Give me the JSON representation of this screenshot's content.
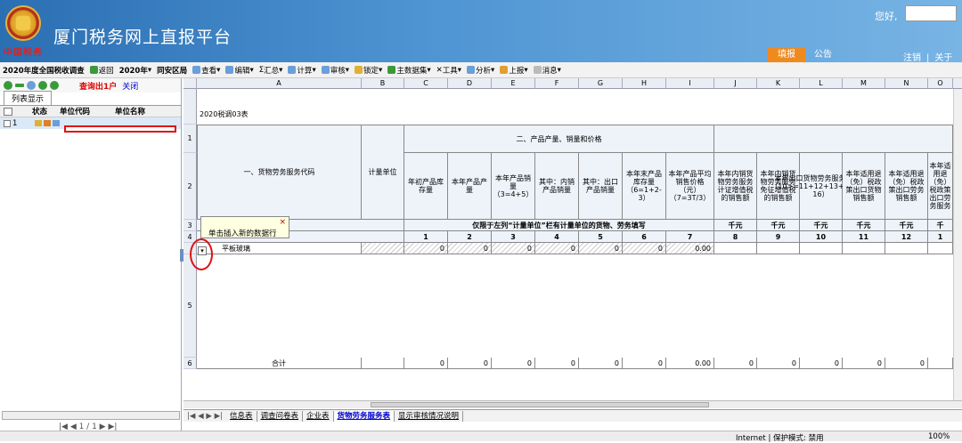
{
  "header": {
    "title": "厦门税务网上直报平台",
    "logo_text": "中国税务",
    "greeting": "您好,",
    "tab_active": "填报",
    "tab_other": "公告",
    "link_logout": "注销",
    "link_about": "关于"
  },
  "toolbar": {
    "survey": "2020年度全国税收调查",
    "back": "返回",
    "year": "2020年",
    "district": "同安区局",
    "items": [
      "查看",
      "编辑",
      "汇总",
      "计算",
      "审核",
      "锁定",
      "主数据集",
      "工具",
      "分析",
      "上报",
      "消息"
    ]
  },
  "left": {
    "query": "查询出1户",
    "close": "关闭",
    "tab": "列表显示",
    "col_status": "状态",
    "col_code": "单位代码",
    "col_name": "单位名称",
    "row_num": "1",
    "pager": "|◀ ◀  1 / 1  ▶ ▶|"
  },
  "sheet": {
    "col_letters": [
      "A",
      "B",
      "C",
      "D",
      "E",
      "F",
      "G",
      "H",
      "I",
      "J",
      "K",
      "L",
      "M",
      "N",
      "O"
    ],
    "row_labels": [
      "1",
      "2",
      "3",
      "4",
      "",
      "5",
      "6"
    ],
    "table_code": "2020税调03表",
    "h_a": "一、货物劳务服务代码",
    "h_b": "计量单位",
    "h_group": "二、产品产量、销量和价格",
    "h_cols": [
      "年初产品库存量",
      "本年产品产量",
      "本年产品销量（3=4+5）",
      "其中：内销产品销量",
      "其中：出口产品销量",
      "本年末产品库存量（6=1+2-3）",
      "本年产品平均销售价格（元）（7=3T/3）",
      "本年内销货物劳务服务计证增值税的销售额",
      "本年内销货物劳务服务免征增值税的销售额",
      "本年出口货物劳务服务销售额（10>=11+12+13+14+15-16）",
      "本年适用退（免）税政策出口货物销售额",
      "本年适用退（免）税政策出口劳务销售额",
      "本年适用退（免）税政策出口劳务服务"
    ],
    "note_row3": "仅限于左列“计量单位”栏有计量单位的货物、劳务填写",
    "units": [
      "千元",
      "千元",
      "千元",
      "千元",
      "千元",
      "千"
    ],
    "col_nums": [
      "1",
      "2",
      "3",
      "4",
      "5",
      "6",
      "7",
      "8",
      "9",
      "10",
      "11",
      "12",
      "1"
    ],
    "data_name": "平板玻璃",
    "data_vals": [
      "0",
      "0",
      "0",
      "0",
      "0",
      "0",
      "0.00"
    ],
    "total_label": "合计",
    "total_vals": [
      "0",
      "0",
      "0",
      "0",
      "0",
      "0",
      "0.00",
      "0",
      "0",
      "0",
      "0",
      "0"
    ],
    "tooltip": "单击插入新的数据行"
  },
  "sheet_tabs": [
    "信息表",
    "调查问卷表",
    "企业表",
    "货物劳务服务表",
    "显示审核情况说明"
  ],
  "status": {
    "zone": "Internet | 保护模式: 禁用",
    "zoom": "100%"
  }
}
